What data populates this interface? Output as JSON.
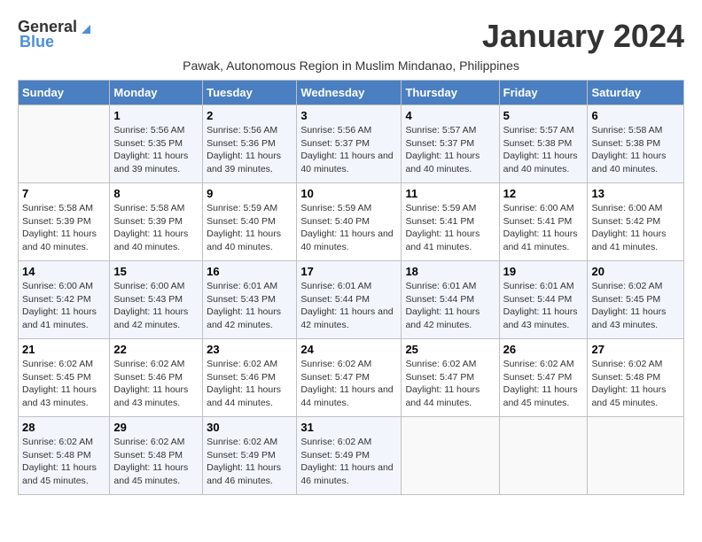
{
  "logo": {
    "general": "General",
    "blue": "Blue"
  },
  "title": "January 2024",
  "subtitle": "Pawak, Autonomous Region in Muslim Mindanao, Philippines",
  "days_of_week": [
    "Sunday",
    "Monday",
    "Tuesday",
    "Wednesday",
    "Thursday",
    "Friday",
    "Saturday"
  ],
  "weeks": [
    [
      {
        "day": "",
        "info": ""
      },
      {
        "day": "1",
        "info": "Sunrise: 5:56 AM\nSunset: 5:35 PM\nDaylight: 11 hours and 39 minutes."
      },
      {
        "day": "2",
        "info": "Sunrise: 5:56 AM\nSunset: 5:36 PM\nDaylight: 11 hours and 39 minutes."
      },
      {
        "day": "3",
        "info": "Sunrise: 5:56 AM\nSunset: 5:37 PM\nDaylight: 11 hours and 40 minutes."
      },
      {
        "day": "4",
        "info": "Sunrise: 5:57 AM\nSunset: 5:37 PM\nDaylight: 11 hours and 40 minutes."
      },
      {
        "day": "5",
        "info": "Sunrise: 5:57 AM\nSunset: 5:38 PM\nDaylight: 11 hours and 40 minutes."
      },
      {
        "day": "6",
        "info": "Sunrise: 5:58 AM\nSunset: 5:38 PM\nDaylight: 11 hours and 40 minutes."
      }
    ],
    [
      {
        "day": "7",
        "info": "Sunrise: 5:58 AM\nSunset: 5:39 PM\nDaylight: 11 hours and 40 minutes."
      },
      {
        "day": "8",
        "info": "Sunrise: 5:58 AM\nSunset: 5:39 PM\nDaylight: 11 hours and 40 minutes."
      },
      {
        "day": "9",
        "info": "Sunrise: 5:59 AM\nSunset: 5:40 PM\nDaylight: 11 hours and 40 minutes."
      },
      {
        "day": "10",
        "info": "Sunrise: 5:59 AM\nSunset: 5:40 PM\nDaylight: 11 hours and 40 minutes."
      },
      {
        "day": "11",
        "info": "Sunrise: 5:59 AM\nSunset: 5:41 PM\nDaylight: 11 hours and 41 minutes."
      },
      {
        "day": "12",
        "info": "Sunrise: 6:00 AM\nSunset: 5:41 PM\nDaylight: 11 hours and 41 minutes."
      },
      {
        "day": "13",
        "info": "Sunrise: 6:00 AM\nSunset: 5:42 PM\nDaylight: 11 hours and 41 minutes."
      }
    ],
    [
      {
        "day": "14",
        "info": "Sunrise: 6:00 AM\nSunset: 5:42 PM\nDaylight: 11 hours and 41 minutes."
      },
      {
        "day": "15",
        "info": "Sunrise: 6:00 AM\nSunset: 5:43 PM\nDaylight: 11 hours and 42 minutes."
      },
      {
        "day": "16",
        "info": "Sunrise: 6:01 AM\nSunset: 5:43 PM\nDaylight: 11 hours and 42 minutes."
      },
      {
        "day": "17",
        "info": "Sunrise: 6:01 AM\nSunset: 5:44 PM\nDaylight: 11 hours and 42 minutes."
      },
      {
        "day": "18",
        "info": "Sunrise: 6:01 AM\nSunset: 5:44 PM\nDaylight: 11 hours and 42 minutes."
      },
      {
        "day": "19",
        "info": "Sunrise: 6:01 AM\nSunset: 5:44 PM\nDaylight: 11 hours and 43 minutes."
      },
      {
        "day": "20",
        "info": "Sunrise: 6:02 AM\nSunset: 5:45 PM\nDaylight: 11 hours and 43 minutes."
      }
    ],
    [
      {
        "day": "21",
        "info": "Sunrise: 6:02 AM\nSunset: 5:45 PM\nDaylight: 11 hours and 43 minutes."
      },
      {
        "day": "22",
        "info": "Sunrise: 6:02 AM\nSunset: 5:46 PM\nDaylight: 11 hours and 43 minutes."
      },
      {
        "day": "23",
        "info": "Sunrise: 6:02 AM\nSunset: 5:46 PM\nDaylight: 11 hours and 44 minutes."
      },
      {
        "day": "24",
        "info": "Sunrise: 6:02 AM\nSunset: 5:47 PM\nDaylight: 11 hours and 44 minutes."
      },
      {
        "day": "25",
        "info": "Sunrise: 6:02 AM\nSunset: 5:47 PM\nDaylight: 11 hours and 44 minutes."
      },
      {
        "day": "26",
        "info": "Sunrise: 6:02 AM\nSunset: 5:47 PM\nDaylight: 11 hours and 45 minutes."
      },
      {
        "day": "27",
        "info": "Sunrise: 6:02 AM\nSunset: 5:48 PM\nDaylight: 11 hours and 45 minutes."
      }
    ],
    [
      {
        "day": "28",
        "info": "Sunrise: 6:02 AM\nSunset: 5:48 PM\nDaylight: 11 hours and 45 minutes."
      },
      {
        "day": "29",
        "info": "Sunrise: 6:02 AM\nSunset: 5:48 PM\nDaylight: 11 hours and 45 minutes."
      },
      {
        "day": "30",
        "info": "Sunrise: 6:02 AM\nSunset: 5:49 PM\nDaylight: 11 hours and 46 minutes."
      },
      {
        "day": "31",
        "info": "Sunrise: 6:02 AM\nSunset: 5:49 PM\nDaylight: 11 hours and 46 minutes."
      },
      {
        "day": "",
        "info": ""
      },
      {
        "day": "",
        "info": ""
      },
      {
        "day": "",
        "info": ""
      }
    ]
  ]
}
